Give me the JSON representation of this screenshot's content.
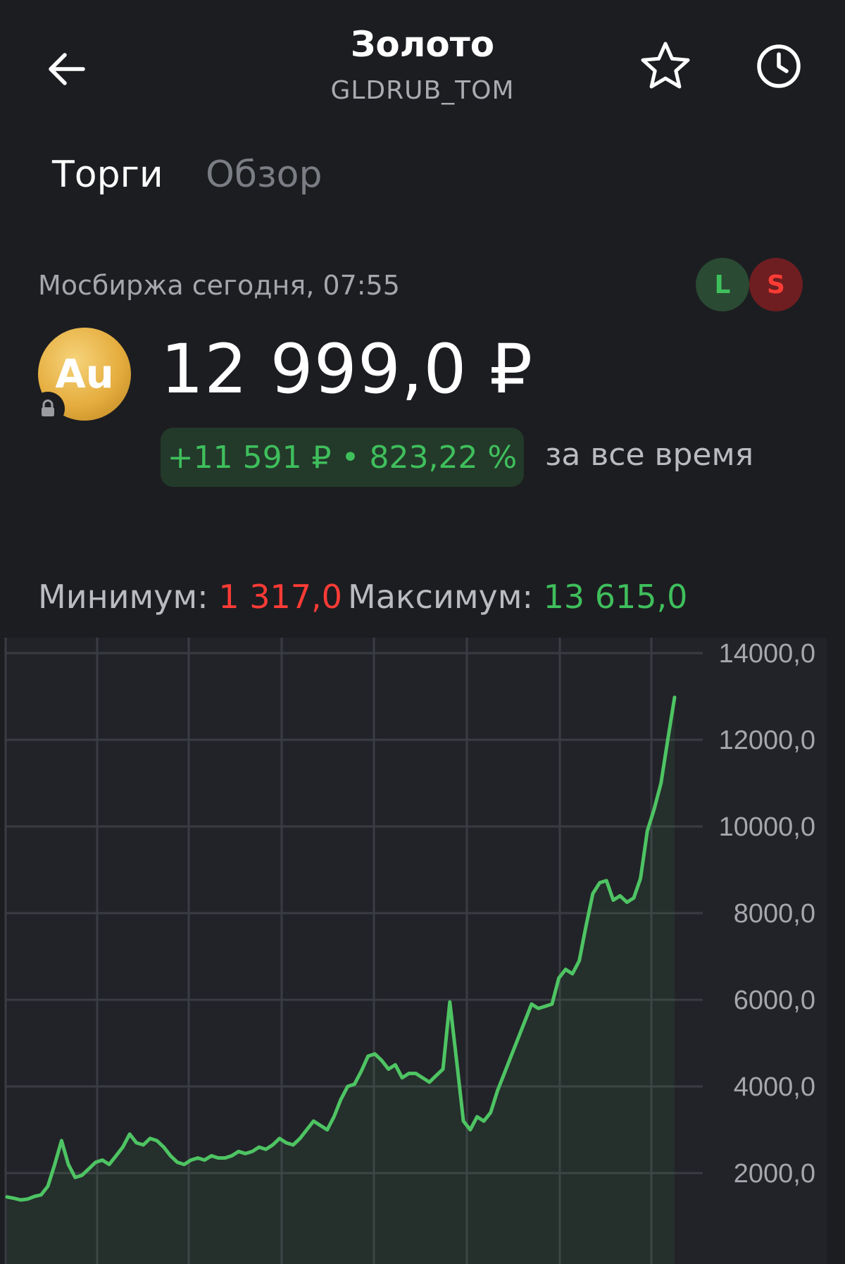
{
  "header": {
    "title": "Золото",
    "ticker": "GLDRUB_TOM",
    "icons": [
      "arrow-left-icon",
      "star-icon",
      "clock-icon"
    ]
  },
  "tabs": [
    {
      "label": "Торги",
      "active": true
    },
    {
      "label": "Обзор",
      "active": false
    }
  ],
  "market": {
    "text": "Мосбиржа  сегодня, 07:55",
    "badge_long": "L",
    "badge_short": "S"
  },
  "asset": {
    "icon_text": "Au",
    "price": "12 999,0 ₽",
    "change": "+11 591 ₽ • 823,22 %",
    "period": "за все время"
  },
  "range": {
    "min_label": "Минимум: ",
    "min_value": "1 317,0",
    "max_label": "Максимум: ",
    "max_value": "13 615,0"
  },
  "colors": {
    "background": "#1c1d21",
    "up": "#3fbf5c",
    "down": "#ff3b35",
    "line": "#4ec463"
  },
  "chart_data": {
    "type": "line",
    "ylim": [
      0,
      14600
    ],
    "ytick_values": [
      14000,
      12000,
      10000,
      8000,
      6000,
      4000,
      2000
    ],
    "ytick_labels": [
      "14000,0",
      "12000,0",
      "10000,0",
      "8000,0",
      "6000,0",
      "4000,0",
      "2000,0"
    ],
    "grid": true,
    "series": [
      {
        "values": [
          1450,
          1420,
          1380,
          1400,
          1460,
          1500,
          1700,
          2200,
          2750,
          2200,
          1900,
          1950,
          2100,
          2250,
          2300,
          2200,
          2400,
          2600,
          2900,
          2700,
          2650,
          2800,
          2750,
          2600,
          2400,
          2250,
          2200,
          2300,
          2350,
          2300,
          2400,
          2350,
          2350,
          2400,
          2500,
          2450,
          2500,
          2600,
          2550,
          2650,
          2800,
          2700,
          2650,
          2800,
          3000,
          3200,
          3100,
          3000,
          3300,
          3700,
          4000,
          4050,
          4350,
          4700,
          4750,
          4600,
          4400,
          4500,
          4200,
          4300,
          4300,
          4200,
          4100,
          4250,
          4400,
          5950,
          4600,
          3200,
          3000,
          3300,
          3200,
          3400,
          3900,
          4300,
          4700,
          5100,
          5500,
          5900,
          5800,
          5850,
          5900,
          6500,
          6700,
          6600,
          6900,
          7700,
          8450,
          8700,
          8750,
          8300,
          8400,
          8250,
          8350,
          8800,
          9900,
          10400,
          11000,
          12000,
          12980
        ]
      }
    ]
  }
}
